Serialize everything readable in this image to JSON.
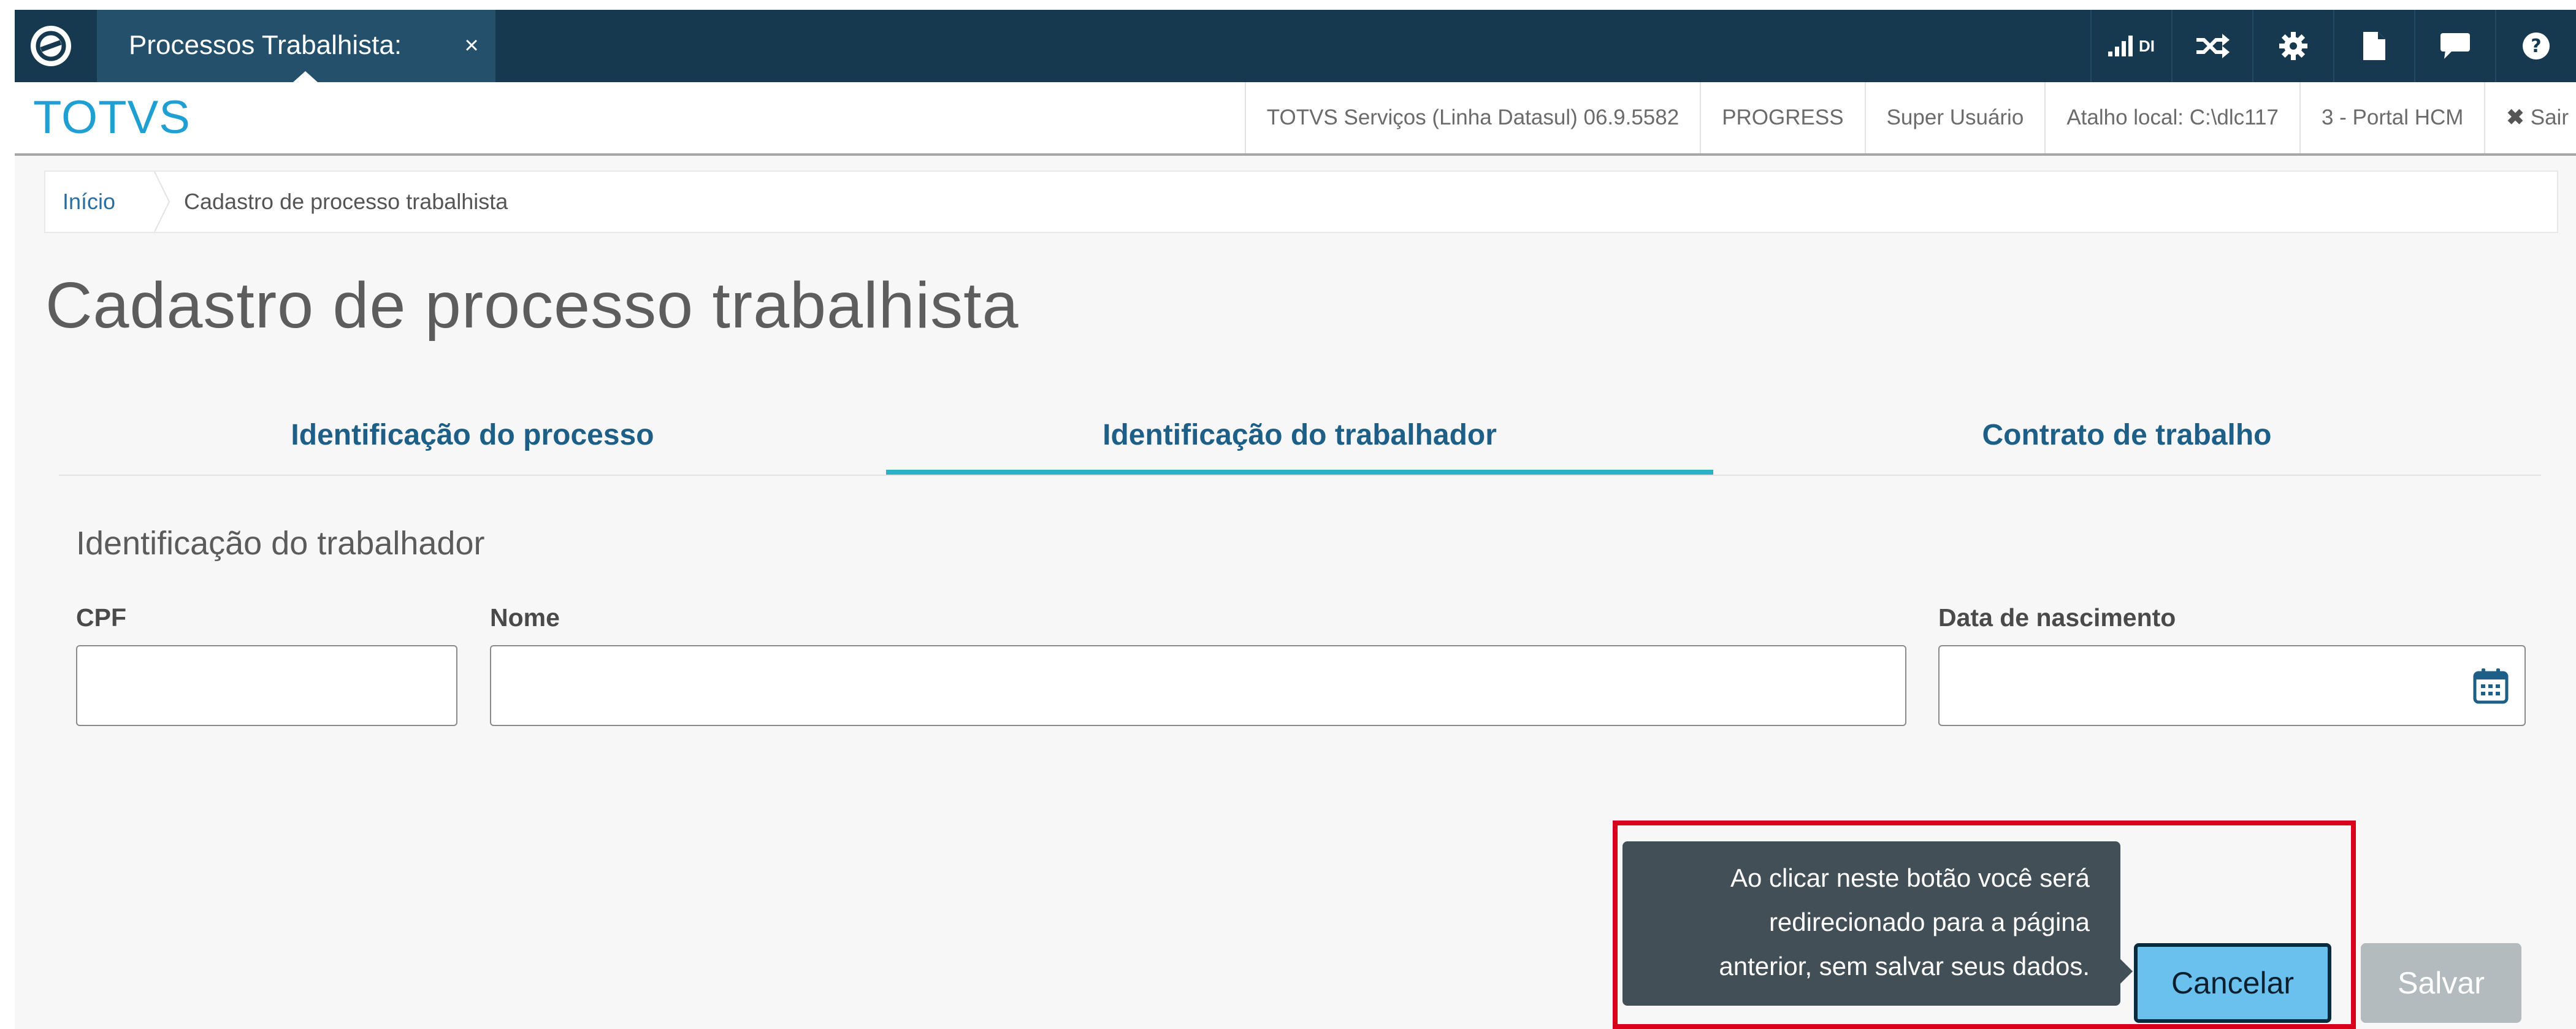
{
  "app": {
    "tab_title": "Processos Trabalhista:",
    "tab_close": "×",
    "brand": "TOTVS",
    "topbar_icons": [
      "signal-bars-icon",
      "shuffle-icon",
      "gear-icon",
      "document-icon",
      "chat-icon",
      "help-icon"
    ],
    "signal_label": "DI"
  },
  "header": {
    "items": [
      "TOTVS Serviços (Linha Datasul) 06.9.5582",
      "PROGRESS",
      "Super Usuário",
      "Atalho local: C:\\dlc117",
      "3 - Portal HCM"
    ],
    "logout_label": "Sair"
  },
  "breadcrumb": {
    "home": "Início",
    "current": "Cadastro de processo trabalhista"
  },
  "page": {
    "title": "Cadastro de processo trabalhista"
  },
  "steps": [
    {
      "label": "Identificação do processo",
      "active": false
    },
    {
      "label": "Identificação do trabalhador",
      "active": true
    },
    {
      "label": "Contrato de trabalho",
      "active": false
    }
  ],
  "section": {
    "title": "Identificação do trabalhador",
    "fields": {
      "cpf": {
        "label": "CPF",
        "value": ""
      },
      "nome": {
        "label": "Nome",
        "value": ""
      },
      "data_nascimento": {
        "label": "Data de nascimento",
        "value": "",
        "icon": "calendar-icon"
      }
    }
  },
  "tooltip": {
    "lines": [
      "Ao clicar neste botão você será",
      "redirecionado para a página",
      "anterior, sem salvar seus dados."
    ]
  },
  "actions": {
    "cancel_label": "Cancelar",
    "save_label": "Salvar"
  },
  "colors": {
    "topbar": "#17394f",
    "brand": "#1f9fd2",
    "step_text": "#1d5f86",
    "step_active_underline": "#29b2c0",
    "cancel_button": "#6ac1ee",
    "save_button_disabled": "#b4bbbf",
    "highlight_box": "#d9001b"
  }
}
